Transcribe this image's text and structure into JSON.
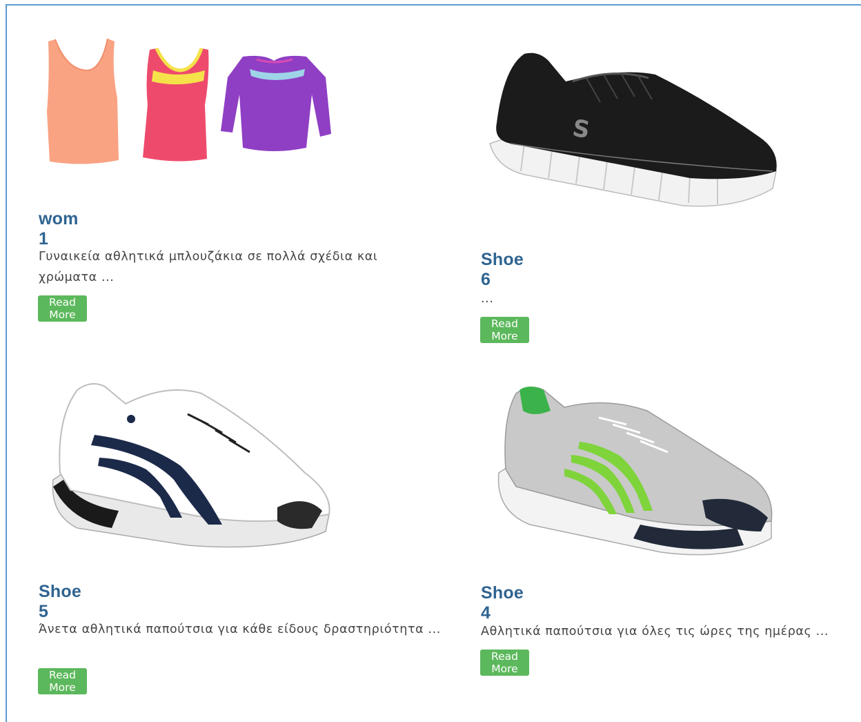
{
  "products": [
    {
      "title": "wom 1",
      "description": "Γυναικεία αθλητικά μπλουζάκια σε πολλά σχέδια και χρώματα ...",
      "button": "Read More"
    },
    {
      "title": "Shoe 6",
      "description": "...",
      "button": "Read More"
    },
    {
      "title": "Shoe 5",
      "description": "Άνετα αθλητικά παπούτσια για κάθε είδους δραστηριότητα ...",
      "button": "Read More"
    },
    {
      "title": "Shoe 4",
      "description": "Αθλητικά παπούτσια για όλες τις ώρες της ημέρας ...",
      "button": "Read More"
    }
  ],
  "colors": {
    "title": "#2f6491",
    "button": "#5cb85c",
    "frame": "#5b9bd5"
  }
}
